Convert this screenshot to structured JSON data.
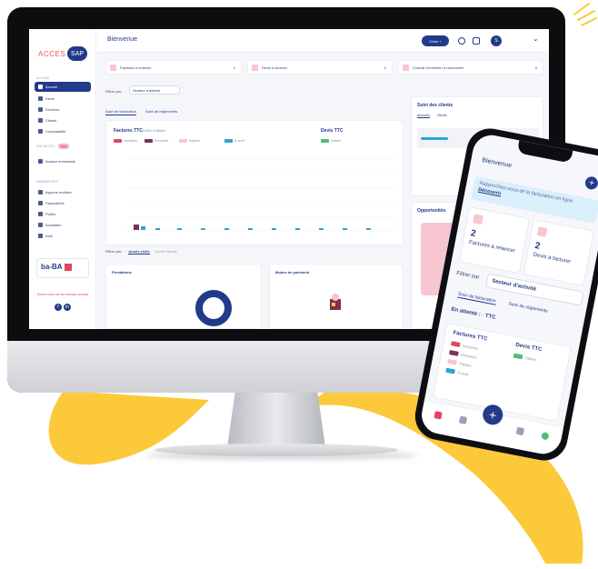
{
  "colors": {
    "primary": "#233a8a",
    "accent": "#e2465e",
    "yellow": "#fcc93a",
    "pink": "#f7c6d0"
  },
  "desktop": {
    "logo": {
      "left": "ACCES",
      "right": "SAP"
    },
    "page_title": "Bienvenue",
    "create_button": "Créer +",
    "avatar_initial": "S",
    "nav_section_1": "ACCUEIL",
    "nav": [
      {
        "label": "Accueil",
        "icon": "home-icon"
      },
      {
        "label": "Devis",
        "icon": "document-icon"
      },
      {
        "label": "Services",
        "icon": "list-icon"
      },
      {
        "label": "Clients",
        "icon": "users-icon"
      },
      {
        "label": "Comptabilité",
        "icon": "calculator-icon"
      }
    ],
    "nav_section_2": "SAP ACCES",
    "nav_new_badge": "New",
    "nav_avance": "Avance immédiate",
    "nav_section_3": "PARAMÈTRES",
    "nav2": [
      {
        "label": "Apports mobiles",
        "icon": "phone-icon"
      },
      {
        "label": "Paramètres",
        "icon": "gear-icon"
      },
      {
        "label": "Profils",
        "icon": "user-icon"
      },
      {
        "label": "Actualités",
        "icon": "news-icon"
      },
      {
        "label": "Aide",
        "icon": "help-icon"
      }
    ],
    "promo_text": "ba-BA",
    "follow_text": "Suivez-nous sur les réseaux sociaux",
    "alerts": [
      {
        "label": "Factures à relancer",
        "count": "1"
      },
      {
        "label": "Devis à facturer",
        "count": "2"
      },
      {
        "label": "Contrat d'entretien à renouveler",
        "count": "0"
      }
    ],
    "filter_label": "Filtrer par :",
    "filter_value": "Secteur d'activité",
    "tabs": [
      "Suivi de facturation",
      "Suivi de règlements"
    ],
    "chart_title": "Factures TTC",
    "chart_subtitle": "Chiffre d'affaires",
    "chart_title_2": "Devis TTC",
    "legend": [
      {
        "label": "Impayées",
        "color": "#e2465e"
      },
      {
        "label": "Envoyées",
        "color": "#7a2f58"
      },
      {
        "label": "Payées",
        "color": "#f4c8d2"
      },
      {
        "label": "À venir",
        "color": "#2aa6d8"
      }
    ],
    "legend_2": [
      {
        "label": "Validés",
        "color": "#4fbe75"
      }
    ],
    "filter2_label": "Filtrer par :",
    "filter2_options": [
      "Année civile",
      "Année fiscale"
    ],
    "card_bottom_1": "Prestations",
    "card_bottom_2": "Modes de paiement",
    "side_title": "Suivi des clients",
    "side_tabs": [
      "Abonnés",
      "Clients"
    ],
    "side_title_2": "Opportunités"
  },
  "phone": {
    "title": "Bienvenue",
    "banner_text": "Rapprochez-vous de la facturation en ligne",
    "banner_link": "Découvrir",
    "cards": [
      {
        "number": "2",
        "label": "Factures à relancer"
      },
      {
        "number": "2",
        "label": "Devis à facturer"
      }
    ],
    "filter_label": "Filtrer par",
    "filter_value": "Secteur d'activité",
    "tabs": [
      "Suivi de facturation",
      "Suivi de règlements"
    ],
    "attente_label": "En attente :",
    "attente_value": "-",
    "attente_unit": "TTC",
    "chart_title_1": "Factures TTC",
    "chart_title_2": "Devis TTC",
    "legend": [
      {
        "label": "Impayées",
        "color": "#e2465e"
      },
      {
        "label": "Envoyées",
        "color": "#7a2f58"
      },
      {
        "label": "Payées",
        "color": "#f4c8d2"
      },
      {
        "label": "À venir",
        "color": "#2aa6d8"
      }
    ],
    "legend_2": [
      {
        "label": "Validés",
        "color": "#4fbe75"
      }
    ]
  }
}
